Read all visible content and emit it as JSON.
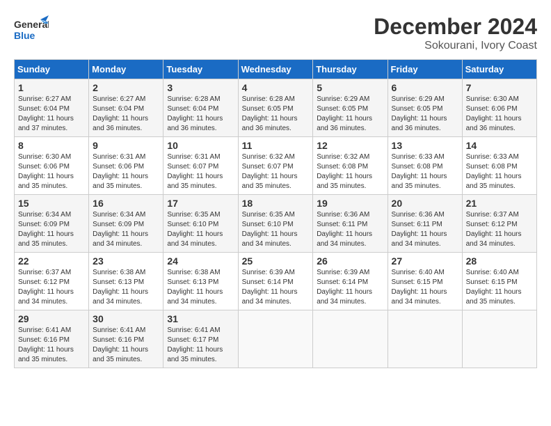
{
  "header": {
    "logo_general": "General",
    "logo_blue": "Blue",
    "month": "December 2024",
    "location": "Sokourani, Ivory Coast"
  },
  "weekdays": [
    "Sunday",
    "Monday",
    "Tuesday",
    "Wednesday",
    "Thursday",
    "Friday",
    "Saturday"
  ],
  "weeks": [
    [
      {
        "day": "1",
        "sunrise": "6:27 AM",
        "sunset": "6:04 PM",
        "daylight": "11 hours and 37 minutes"
      },
      {
        "day": "2",
        "sunrise": "6:27 AM",
        "sunset": "6:04 PM",
        "daylight": "11 hours and 36 minutes"
      },
      {
        "day": "3",
        "sunrise": "6:28 AM",
        "sunset": "6:04 PM",
        "daylight": "11 hours and 36 minutes"
      },
      {
        "day": "4",
        "sunrise": "6:28 AM",
        "sunset": "6:05 PM",
        "daylight": "11 hours and 36 minutes"
      },
      {
        "day": "5",
        "sunrise": "6:29 AM",
        "sunset": "6:05 PM",
        "daylight": "11 hours and 36 minutes"
      },
      {
        "day": "6",
        "sunrise": "6:29 AM",
        "sunset": "6:05 PM",
        "daylight": "11 hours and 36 minutes"
      },
      {
        "day": "7",
        "sunrise": "6:30 AM",
        "sunset": "6:06 PM",
        "daylight": "11 hours and 36 minutes"
      }
    ],
    [
      {
        "day": "8",
        "sunrise": "6:30 AM",
        "sunset": "6:06 PM",
        "daylight": "11 hours and 35 minutes"
      },
      {
        "day": "9",
        "sunrise": "6:31 AM",
        "sunset": "6:06 PM",
        "daylight": "11 hours and 35 minutes"
      },
      {
        "day": "10",
        "sunrise": "6:31 AM",
        "sunset": "6:07 PM",
        "daylight": "11 hours and 35 minutes"
      },
      {
        "day": "11",
        "sunrise": "6:32 AM",
        "sunset": "6:07 PM",
        "daylight": "11 hours and 35 minutes"
      },
      {
        "day": "12",
        "sunrise": "6:32 AM",
        "sunset": "6:08 PM",
        "daylight": "11 hours and 35 minutes"
      },
      {
        "day": "13",
        "sunrise": "6:33 AM",
        "sunset": "6:08 PM",
        "daylight": "11 hours and 35 minutes"
      },
      {
        "day": "14",
        "sunrise": "6:33 AM",
        "sunset": "6:08 PM",
        "daylight": "11 hours and 35 minutes"
      }
    ],
    [
      {
        "day": "15",
        "sunrise": "6:34 AM",
        "sunset": "6:09 PM",
        "daylight": "11 hours and 35 minutes"
      },
      {
        "day": "16",
        "sunrise": "6:34 AM",
        "sunset": "6:09 PM",
        "daylight": "11 hours and 34 minutes"
      },
      {
        "day": "17",
        "sunrise": "6:35 AM",
        "sunset": "6:10 PM",
        "daylight": "11 hours and 34 minutes"
      },
      {
        "day": "18",
        "sunrise": "6:35 AM",
        "sunset": "6:10 PM",
        "daylight": "11 hours and 34 minutes"
      },
      {
        "day": "19",
        "sunrise": "6:36 AM",
        "sunset": "6:11 PM",
        "daylight": "11 hours and 34 minutes"
      },
      {
        "day": "20",
        "sunrise": "6:36 AM",
        "sunset": "6:11 PM",
        "daylight": "11 hours and 34 minutes"
      },
      {
        "day": "21",
        "sunrise": "6:37 AM",
        "sunset": "6:12 PM",
        "daylight": "11 hours and 34 minutes"
      }
    ],
    [
      {
        "day": "22",
        "sunrise": "6:37 AM",
        "sunset": "6:12 PM",
        "daylight": "11 hours and 34 minutes"
      },
      {
        "day": "23",
        "sunrise": "6:38 AM",
        "sunset": "6:13 PM",
        "daylight": "11 hours and 34 minutes"
      },
      {
        "day": "24",
        "sunrise": "6:38 AM",
        "sunset": "6:13 PM",
        "daylight": "11 hours and 34 minutes"
      },
      {
        "day": "25",
        "sunrise": "6:39 AM",
        "sunset": "6:14 PM",
        "daylight": "11 hours and 34 minutes"
      },
      {
        "day": "26",
        "sunrise": "6:39 AM",
        "sunset": "6:14 PM",
        "daylight": "11 hours and 34 minutes"
      },
      {
        "day": "27",
        "sunrise": "6:40 AM",
        "sunset": "6:15 PM",
        "daylight": "11 hours and 34 minutes"
      },
      {
        "day": "28",
        "sunrise": "6:40 AM",
        "sunset": "6:15 PM",
        "daylight": "11 hours and 35 minutes"
      }
    ],
    [
      {
        "day": "29",
        "sunrise": "6:41 AM",
        "sunset": "6:16 PM",
        "daylight": "11 hours and 35 minutes"
      },
      {
        "day": "30",
        "sunrise": "6:41 AM",
        "sunset": "6:16 PM",
        "daylight": "11 hours and 35 minutes"
      },
      {
        "day": "31",
        "sunrise": "6:41 AM",
        "sunset": "6:17 PM",
        "daylight": "11 hours and 35 minutes"
      },
      null,
      null,
      null,
      null
    ]
  ]
}
